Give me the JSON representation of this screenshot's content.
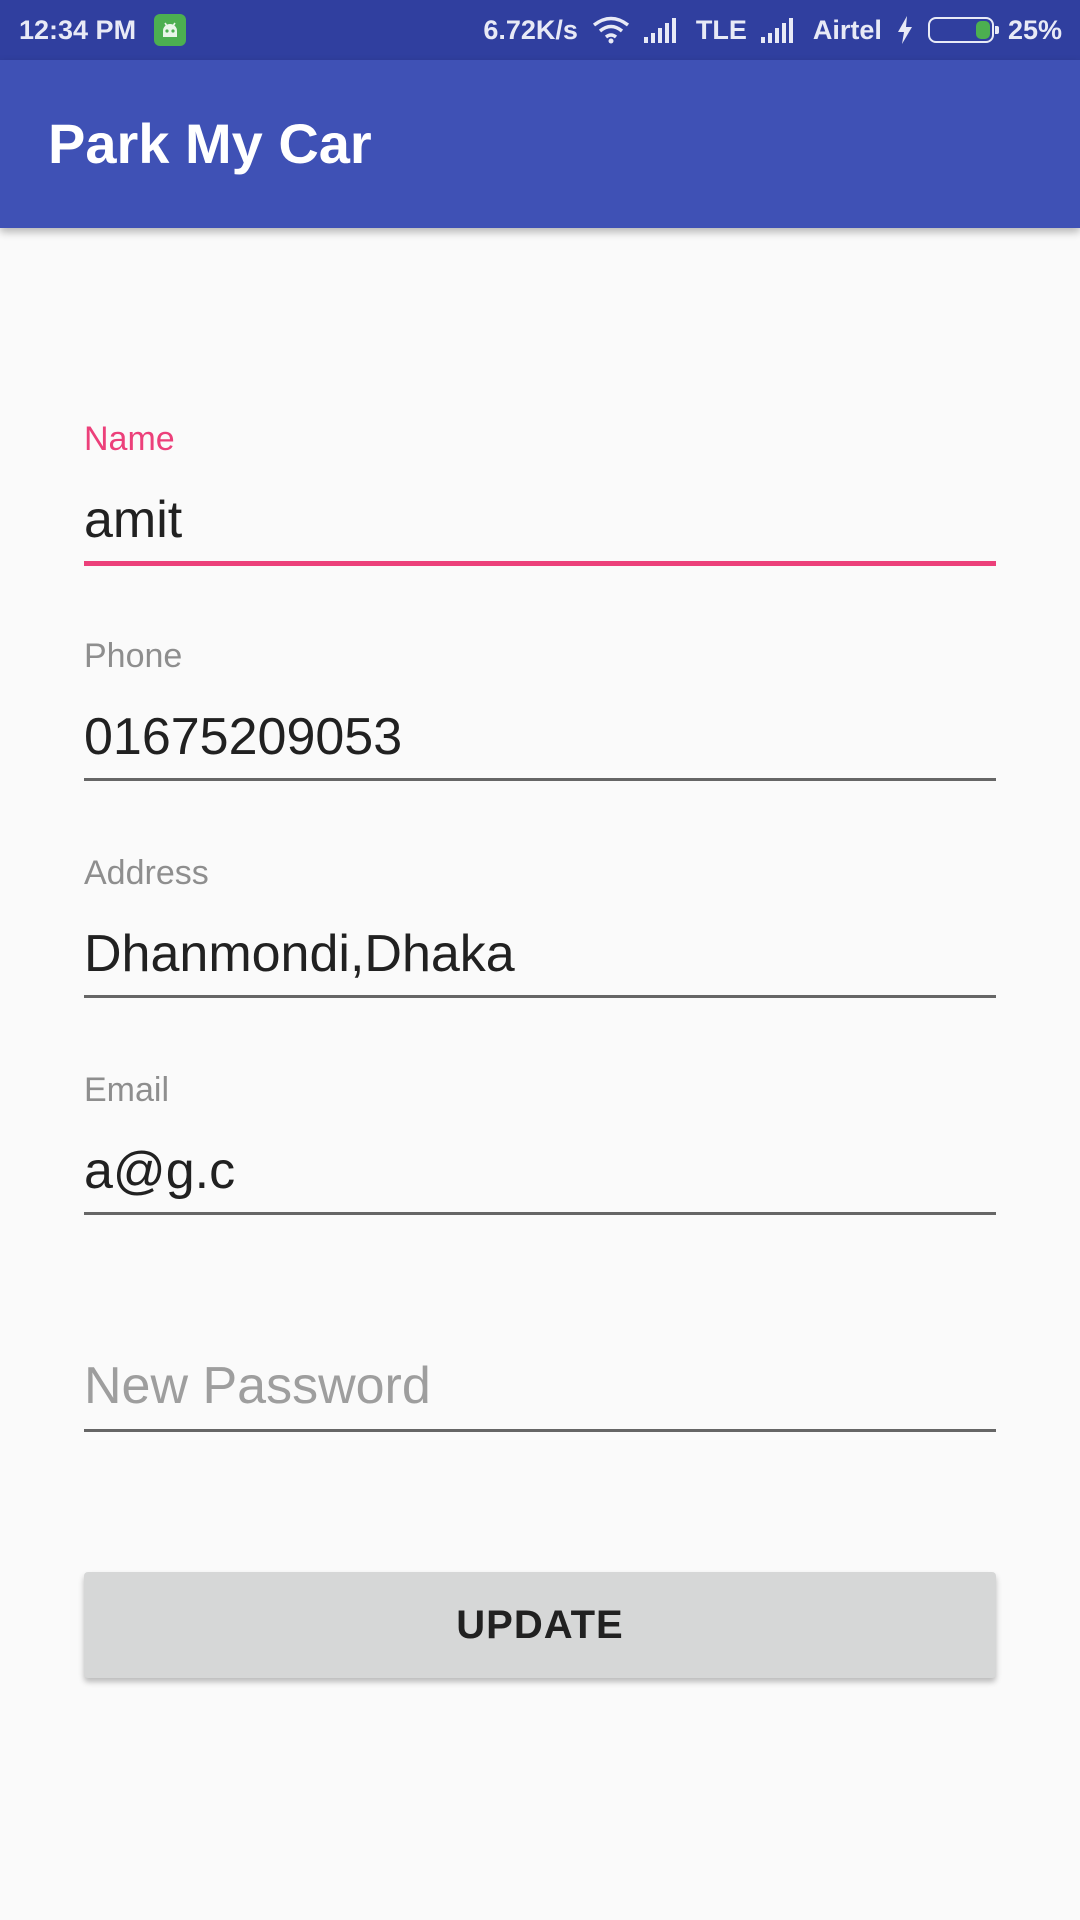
{
  "status_bar": {
    "time": "12:34 PM",
    "speed": "6.72K/s",
    "network_type": "TLE",
    "carrier": "Airtel",
    "battery": "25%",
    "icons": [
      "android-notification-icon",
      "wifi-icon",
      "signal-icon",
      "signal-icon",
      "charging-icon",
      "battery-icon"
    ]
  },
  "toolbar": {
    "title": "Park My Car"
  },
  "form": {
    "name": {
      "label": "Name",
      "value": "amit"
    },
    "phone": {
      "label": "Phone",
      "value": "01675209053"
    },
    "address": {
      "label": "Address",
      "value": "Dhanmondi,Dhaka"
    },
    "email": {
      "label": "Email",
      "value": "a@g.c"
    },
    "new_password": {
      "placeholder": "New Password"
    },
    "update_label": "UPDATE"
  },
  "colors": {
    "status_bar": "#303f9f",
    "primary": "#3f51b5",
    "accent": "#ec407a",
    "background": "#fafafa",
    "button": "#d6d7d7"
  }
}
